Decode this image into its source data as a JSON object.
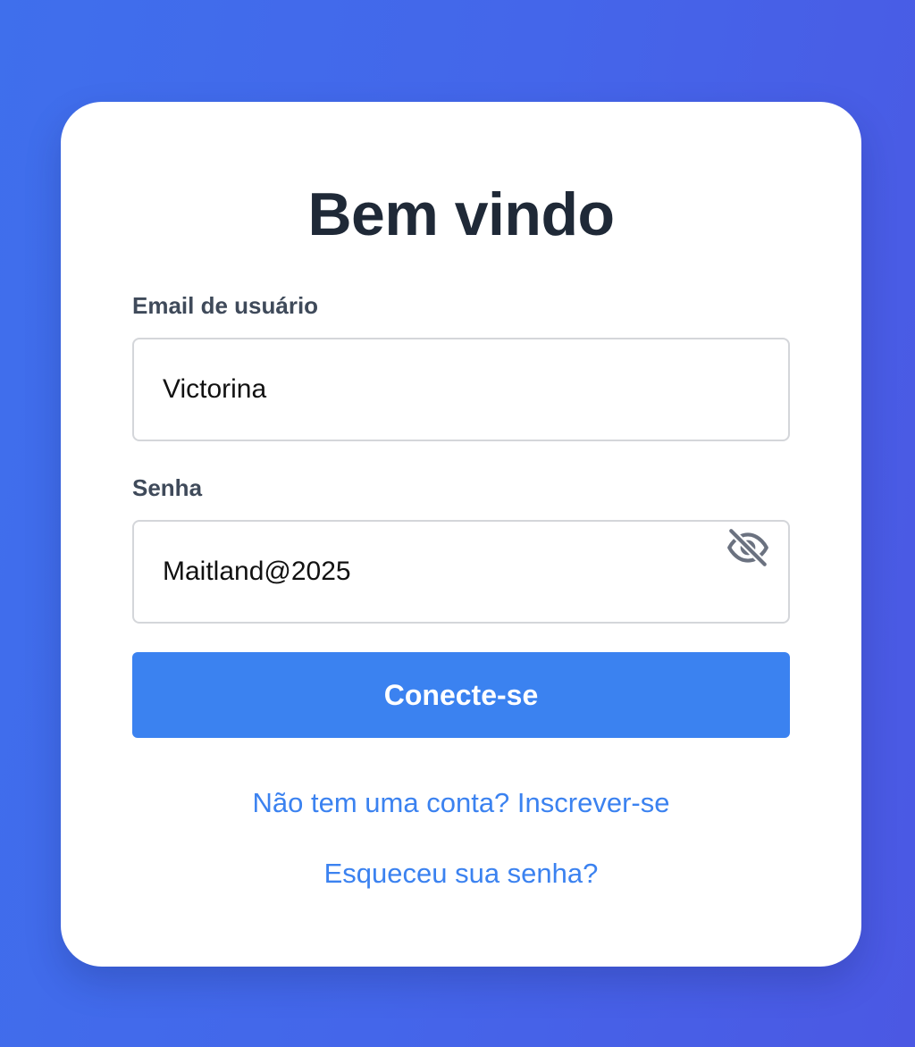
{
  "login": {
    "title": "Bem vindo",
    "email_label": "Email de usuário",
    "email_value": "Victorina",
    "password_label": "Senha",
    "password_value": "Maitland@2025",
    "password_toggle_icon": "eye-off-icon",
    "submit_label": "Conecte-se",
    "signup_link": "Não tem uma conta? Inscrever-se",
    "forgot_link": "Esqueceu sua senha?"
  },
  "colors": {
    "background_start": "#3f6fec",
    "background_end": "#4b58e3",
    "primary": "#3b82f0",
    "title": "#1f2937",
    "label": "#3f4a5a"
  }
}
